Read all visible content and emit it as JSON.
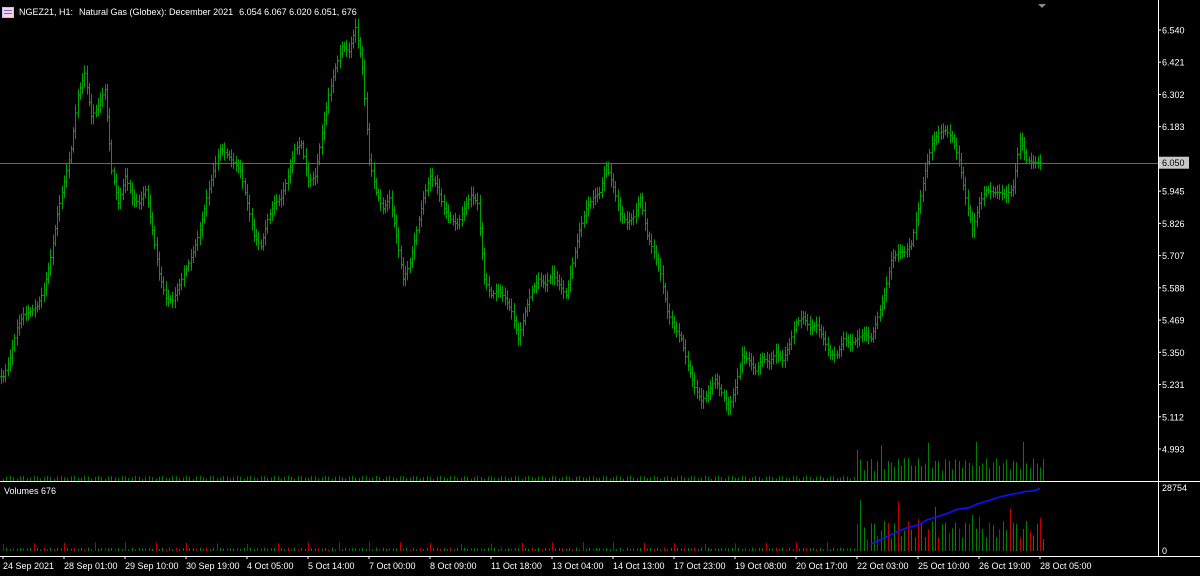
{
  "header": {
    "symbol": "NGEZ21, H1:",
    "description": "Natural Gas (Globex): December 2021",
    "ohlc": "6.054 6.067 6.020 6.051",
    "volume": "676"
  },
  "volumes_panel": {
    "title": "Volumes 676"
  },
  "colors": {
    "background": "#000000",
    "bar_up": "#00a000",
    "bar_down": "#00a000",
    "price_line": "#c04040",
    "volume_up": "#008000",
    "volume_down": "#c00000",
    "volume_ma": "#1010ff",
    "grid_text": "#ffffff"
  },
  "chart_data": [
    {
      "type": "line",
      "series_style": "ohlc-bars",
      "title": "NGEZ21, H1: Natural Gas (Globex): December 2021",
      "yticks": [
        "6.540",
        "6.421",
        "6.302",
        "6.183",
        "6.050",
        "5.945",
        "5.826",
        "5.707",
        "5.588",
        "5.469",
        "5.350",
        "5.231",
        "5.112",
        "4.993"
      ],
      "ylim": [
        4.96,
        6.58
      ],
      "current_price": "6.050",
      "xticks": [
        "24 Sep 2021",
        "28 Sep 01:00",
        "29 Sep 10:00",
        "30 Sep 19:00",
        "4 Oct 05:00",
        "5 Oct 14:00",
        "7 Oct 00:00",
        "8 Oct 09:00",
        "11 Oct 18:00",
        "13 Oct 04:00",
        "14 Oct 13:00",
        "17 Oct 23:00",
        "19 Oct 08:00",
        "20 Oct 17:00",
        "22 Oct 03:00",
        "25 Oct 10:00",
        "26 Oct 19:00",
        "28 Oct 05:00"
      ],
      "series": [
        {
          "values": [
            5.26,
            5.33,
            5.44,
            5.49,
            5.5,
            5.52,
            5.58,
            5.7,
            5.86,
            5.98,
            6.1,
            6.3,
            6.38,
            6.22,
            6.26,
            6.32,
            6.02,
            5.9,
            6.0,
            5.92,
            5.9,
            5.95,
            5.8,
            5.64,
            5.55,
            5.54,
            5.6,
            5.66,
            5.72,
            5.8,
            5.92,
            6.02,
            6.1,
            6.08,
            6.05,
            6.02,
            5.9,
            5.78,
            5.74,
            5.84,
            5.9,
            5.92,
            6.0,
            6.1,
            6.12,
            5.98,
            6.0,
            6.16,
            6.3,
            6.4,
            6.48,
            6.46,
            6.55,
            6.4,
            6.06,
            5.94,
            5.88,
            5.92,
            5.78,
            5.62,
            5.68,
            5.8,
            5.92,
            6.0,
            5.96,
            5.88,
            5.84,
            5.82,
            5.88,
            5.93,
            5.9,
            5.62,
            5.56,
            5.58,
            5.55,
            5.5,
            5.4,
            5.5,
            5.58,
            5.62,
            5.6,
            5.64,
            5.6,
            5.56,
            5.68,
            5.8,
            5.88,
            5.92,
            5.94,
            6.04,
            5.96,
            5.86,
            5.83,
            5.85,
            5.92,
            5.78,
            5.72,
            5.64,
            5.5,
            5.44,
            5.4,
            5.3,
            5.22,
            5.17,
            5.2,
            5.25,
            5.2,
            5.14,
            5.22,
            5.34,
            5.32,
            5.28,
            5.33,
            5.31,
            5.35,
            5.32,
            5.38,
            5.46,
            5.48,
            5.44,
            5.45,
            5.4,
            5.34,
            5.34,
            5.4,
            5.38,
            5.4,
            5.42,
            5.4,
            5.48,
            5.56,
            5.69,
            5.72,
            5.72,
            5.75,
            5.88,
            6.02,
            6.12,
            6.16,
            6.17,
            6.14,
            6.06,
            5.92,
            5.8,
            5.9,
            5.95,
            5.94,
            5.94,
            5.93,
            5.96,
            6.14,
            6.06,
            6.05,
            6.05
          ]
        }
      ]
    },
    {
      "type": "bar",
      "title": "Volumes 676",
      "yticks": [
        "28754",
        "0"
      ],
      "ylim": [
        0,
        28754
      ],
      "volume_ma_values": [
        3000,
        4500,
        6000,
        7500,
        9000,
        10300,
        11000,
        12000,
        14000,
        15000,
        16000,
        17000,
        18500,
        19000,
        19500,
        21000,
        22000,
        23000,
        24000,
        24800,
        25500,
        26000,
        26800,
        27000,
        28000
      ],
      "volume_ma_start_index": 128
    }
  ]
}
